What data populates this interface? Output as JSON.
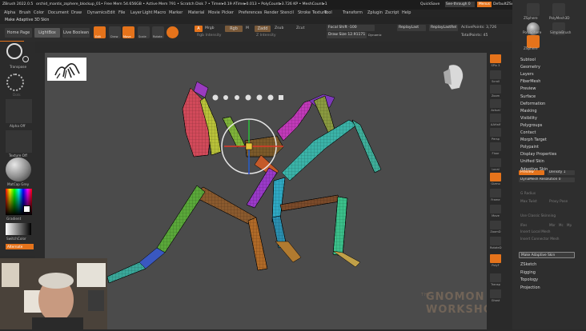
{
  "titlebar": {
    "title": "ZBrush 2022.0.5",
    "doc": "orchid_mantis_zsphere_blockup_01",
    "mem": "• Free Mem 54.656GB • Active Mem 791 • Scratch Disk 7 • Timer▸0.19 ATime▸0.013 • PolyCount▸3.726 KP • MeshCount▸1",
    "quicksave": "QuickSave",
    "seethrough": "See-through 0",
    "menus": "Menus",
    "defaultscript": "DefaultZScript"
  },
  "menubar": [
    "Alpha",
    "Brush",
    "Color",
    "Document",
    "Draw",
    "Dynamics",
    "Edit",
    "File",
    "Layer",
    "Light",
    "Macro",
    "Marker",
    "Material",
    "Movie",
    "Picker",
    "Preferences",
    "Render",
    "Stencil",
    "Stroke",
    "Texture",
    "Tool",
    "Transform",
    "Zplugin",
    "Zscript",
    "Help"
  ],
  "subbar": {
    "text": "Make Adaptive 3D Skin"
  },
  "shelf": {
    "home": "Home Page",
    "lightbox": "LightBox",
    "livebool": "Live Boolean",
    "edit": "Edit",
    "draw": "Draw",
    "move": "Move",
    "scale": "Scale",
    "rotate": "Rotate",
    "a": "A",
    "mrgb": "Mrgb",
    "rgb": "Rgb",
    "m": "M",
    "zadd": "Zadd",
    "zsub": "Zsub",
    "zcut": "Zcut",
    "rgb_intensity": "Rgb Intensity",
    "z_intensity": "Z Intensity",
    "focal_shift": "Focal Shift -100",
    "draw_size": "Draw Size 12.91171",
    "dynamic": "Dynamic",
    "replay_last": "ReplayLast",
    "replay_last_rel": "ReplayLastRel",
    "active_points": "ActivePoints: 3,726",
    "total_points": "TotalPoints: 45"
  },
  "leftpanel": {
    "transpose": "Transpose",
    "dots": "Dots",
    "alpha_off": "Alpha Off",
    "texture_off": "Texture Off",
    "matcap": "MatCap Grey",
    "gradient": "Gradient",
    "switchcolor": "SwitchColor",
    "alternate": "Alternate"
  },
  "rightshelf": [
    {
      "label": "SPix 3"
    },
    {
      "label": "Scroll"
    },
    {
      "label": "Zoom"
    },
    {
      "label": "Actual"
    },
    {
      "label": "AAHalf"
    },
    {
      "label": "Persp"
    },
    {
      "label": "Floor"
    },
    {
      "label": "Local"
    },
    {
      "label": "Gizmo"
    },
    {
      "label": "Frame"
    },
    {
      "label": "Move"
    },
    {
      "label": "ZoomD"
    },
    {
      "label": "RotateD"
    },
    {
      "label": "PolyF"
    },
    {
      "label": "Transp"
    },
    {
      "label": "Ghost"
    }
  ],
  "palette": {
    "tools": [
      "ZSphere",
      "PolyMesh3D",
      "PolySphere",
      "SimpleBrush",
      "ZSphere"
    ],
    "menu": [
      "Subtool",
      "Geometry",
      "Layers",
      "FiberMesh",
      "Preview",
      "Surface",
      "Deformation",
      "Masking",
      "Visibility",
      "Polygroups",
      "Contact",
      "Morph Target",
      "Polypaint",
      "Display Properties",
      "Unified Skin",
      "Adaptive Skin"
    ],
    "preview": "Preview",
    "density": "Density 1",
    "dynamesh_res": "DynaMesh Resolution 0",
    "dim": [
      "G Radius",
      "Max Twist",
      "Proxy Pose",
      "Use Classic Skinning",
      "Insert Local Mesh",
      "Insert Connector Mesh"
    ],
    "ires": "IRes",
    "mbr": "Mbr",
    "mc": "Mc",
    "mp": "Mp",
    "make": "Make Adaptive Skin",
    "bottom": [
      "ZSketch",
      "Rigging",
      "Topology",
      "Projection"
    ]
  },
  "watermark": [
    "THE",
    "GNOMON",
    "WORKSHOP"
  ],
  "colors": {
    "accent": "#e5731b",
    "canvas": "#4b4b4b",
    "panel": "#2e2e2e"
  }
}
